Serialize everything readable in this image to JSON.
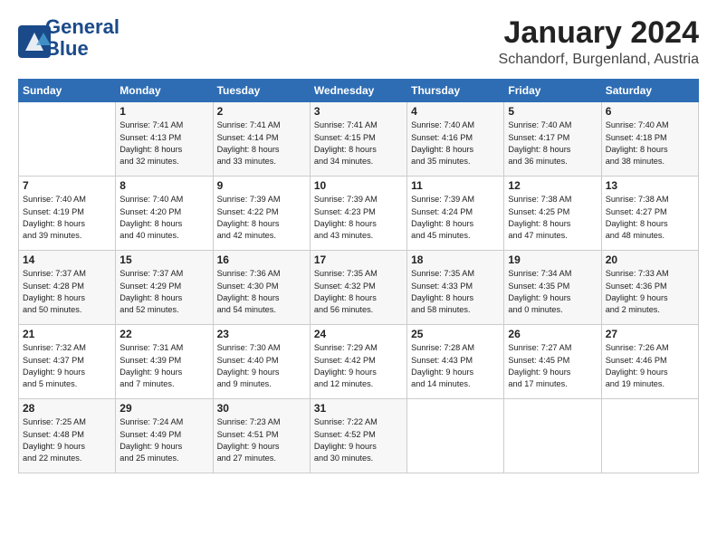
{
  "logo": {
    "line1": "General",
    "line2": "Blue"
  },
  "title": "January 2024",
  "location": "Schandorf, Burgenland, Austria",
  "weekdays": [
    "Sunday",
    "Monday",
    "Tuesday",
    "Wednesday",
    "Thursday",
    "Friday",
    "Saturday"
  ],
  "weeks": [
    [
      {
        "day": "",
        "sunrise": "",
        "sunset": "",
        "daylight": ""
      },
      {
        "day": "1",
        "sunrise": "Sunrise: 7:41 AM",
        "sunset": "Sunset: 4:13 PM",
        "daylight": "Daylight: 8 hours and 32 minutes."
      },
      {
        "day": "2",
        "sunrise": "Sunrise: 7:41 AM",
        "sunset": "Sunset: 4:14 PM",
        "daylight": "Daylight: 8 hours and 33 minutes."
      },
      {
        "day": "3",
        "sunrise": "Sunrise: 7:41 AM",
        "sunset": "Sunset: 4:15 PM",
        "daylight": "Daylight: 8 hours and 34 minutes."
      },
      {
        "day": "4",
        "sunrise": "Sunrise: 7:40 AM",
        "sunset": "Sunset: 4:16 PM",
        "daylight": "Daylight: 8 hours and 35 minutes."
      },
      {
        "day": "5",
        "sunrise": "Sunrise: 7:40 AM",
        "sunset": "Sunset: 4:17 PM",
        "daylight": "Daylight: 8 hours and 36 minutes."
      },
      {
        "day": "6",
        "sunrise": "Sunrise: 7:40 AM",
        "sunset": "Sunset: 4:18 PM",
        "daylight": "Daylight: 8 hours and 38 minutes."
      }
    ],
    [
      {
        "day": "7",
        "sunrise": "Sunrise: 7:40 AM",
        "sunset": "Sunset: 4:19 PM",
        "daylight": "Daylight: 8 hours and 39 minutes."
      },
      {
        "day": "8",
        "sunrise": "Sunrise: 7:40 AM",
        "sunset": "Sunset: 4:20 PM",
        "daylight": "Daylight: 8 hours and 40 minutes."
      },
      {
        "day": "9",
        "sunrise": "Sunrise: 7:39 AM",
        "sunset": "Sunset: 4:22 PM",
        "daylight": "Daylight: 8 hours and 42 minutes."
      },
      {
        "day": "10",
        "sunrise": "Sunrise: 7:39 AM",
        "sunset": "Sunset: 4:23 PM",
        "daylight": "Daylight: 8 hours and 43 minutes."
      },
      {
        "day": "11",
        "sunrise": "Sunrise: 7:39 AM",
        "sunset": "Sunset: 4:24 PM",
        "daylight": "Daylight: 8 hours and 45 minutes."
      },
      {
        "day": "12",
        "sunrise": "Sunrise: 7:38 AM",
        "sunset": "Sunset: 4:25 PM",
        "daylight": "Daylight: 8 hours and 47 minutes."
      },
      {
        "day": "13",
        "sunrise": "Sunrise: 7:38 AM",
        "sunset": "Sunset: 4:27 PM",
        "daylight": "Daylight: 8 hours and 48 minutes."
      }
    ],
    [
      {
        "day": "14",
        "sunrise": "Sunrise: 7:37 AM",
        "sunset": "Sunset: 4:28 PM",
        "daylight": "Daylight: 8 hours and 50 minutes."
      },
      {
        "day": "15",
        "sunrise": "Sunrise: 7:37 AM",
        "sunset": "Sunset: 4:29 PM",
        "daylight": "Daylight: 8 hours and 52 minutes."
      },
      {
        "day": "16",
        "sunrise": "Sunrise: 7:36 AM",
        "sunset": "Sunset: 4:30 PM",
        "daylight": "Daylight: 8 hours and 54 minutes."
      },
      {
        "day": "17",
        "sunrise": "Sunrise: 7:35 AM",
        "sunset": "Sunset: 4:32 PM",
        "daylight": "Daylight: 8 hours and 56 minutes."
      },
      {
        "day": "18",
        "sunrise": "Sunrise: 7:35 AM",
        "sunset": "Sunset: 4:33 PM",
        "daylight": "Daylight: 8 hours and 58 minutes."
      },
      {
        "day": "19",
        "sunrise": "Sunrise: 7:34 AM",
        "sunset": "Sunset: 4:35 PM",
        "daylight": "Daylight: 9 hours and 0 minutes."
      },
      {
        "day": "20",
        "sunrise": "Sunrise: 7:33 AM",
        "sunset": "Sunset: 4:36 PM",
        "daylight": "Daylight: 9 hours and 2 minutes."
      }
    ],
    [
      {
        "day": "21",
        "sunrise": "Sunrise: 7:32 AM",
        "sunset": "Sunset: 4:37 PM",
        "daylight": "Daylight: 9 hours and 5 minutes."
      },
      {
        "day": "22",
        "sunrise": "Sunrise: 7:31 AM",
        "sunset": "Sunset: 4:39 PM",
        "daylight": "Daylight: 9 hours and 7 minutes."
      },
      {
        "day": "23",
        "sunrise": "Sunrise: 7:30 AM",
        "sunset": "Sunset: 4:40 PM",
        "daylight": "Daylight: 9 hours and 9 minutes."
      },
      {
        "day": "24",
        "sunrise": "Sunrise: 7:29 AM",
        "sunset": "Sunset: 4:42 PM",
        "daylight": "Daylight: 9 hours and 12 minutes."
      },
      {
        "day": "25",
        "sunrise": "Sunrise: 7:28 AM",
        "sunset": "Sunset: 4:43 PM",
        "daylight": "Daylight: 9 hours and 14 minutes."
      },
      {
        "day": "26",
        "sunrise": "Sunrise: 7:27 AM",
        "sunset": "Sunset: 4:45 PM",
        "daylight": "Daylight: 9 hours and 17 minutes."
      },
      {
        "day": "27",
        "sunrise": "Sunrise: 7:26 AM",
        "sunset": "Sunset: 4:46 PM",
        "daylight": "Daylight: 9 hours and 19 minutes."
      }
    ],
    [
      {
        "day": "28",
        "sunrise": "Sunrise: 7:25 AM",
        "sunset": "Sunset: 4:48 PM",
        "daylight": "Daylight: 9 hours and 22 minutes."
      },
      {
        "day": "29",
        "sunrise": "Sunrise: 7:24 AM",
        "sunset": "Sunset: 4:49 PM",
        "daylight": "Daylight: 9 hours and 25 minutes."
      },
      {
        "day": "30",
        "sunrise": "Sunrise: 7:23 AM",
        "sunset": "Sunset: 4:51 PM",
        "daylight": "Daylight: 9 hours and 27 minutes."
      },
      {
        "day": "31",
        "sunrise": "Sunrise: 7:22 AM",
        "sunset": "Sunset: 4:52 PM",
        "daylight": "Daylight: 9 hours and 30 minutes."
      },
      {
        "day": "",
        "sunrise": "",
        "sunset": "",
        "daylight": ""
      },
      {
        "day": "",
        "sunrise": "",
        "sunset": "",
        "daylight": ""
      },
      {
        "day": "",
        "sunrise": "",
        "sunset": "",
        "daylight": ""
      }
    ]
  ]
}
